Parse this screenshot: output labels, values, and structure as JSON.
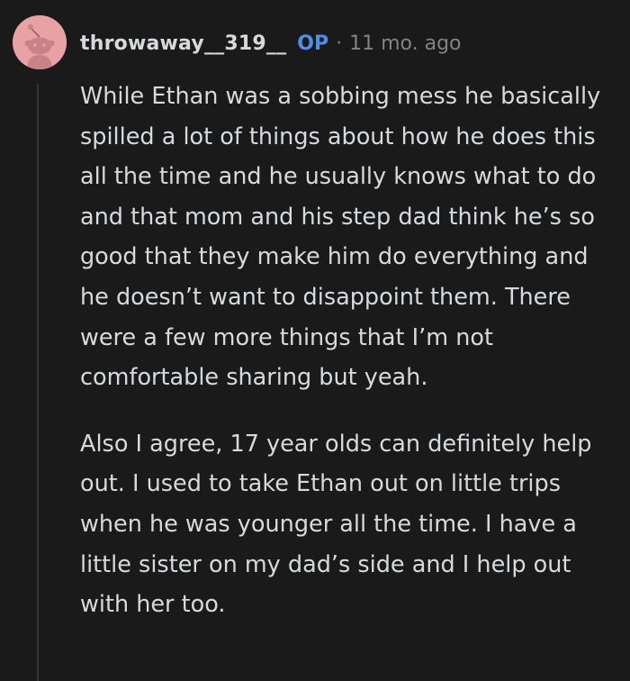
{
  "comment": {
    "author": "throwaway__319__",
    "op_badge": "OP",
    "separator": "·",
    "timestamp": "11 mo. ago",
    "avatar_icon": "snoo-avatar-icon",
    "colors": {
      "background": "#1a1a1b",
      "avatar_bg": "#e8a2a6",
      "op_badge": "#4f8fe6",
      "meta_text": "#818384",
      "body_text": "#d7dadc"
    },
    "paragraphs": [
      "While Ethan was a sobbing mess he basically spilled a lot of things about how he does this all the time and he usually knows what to do and that mom and his step dad think he’s so good that they make him do everything and he doesn’t want to disappoint them. There were a few more things that I’m not comfortable sharing but yeah.",
      "Also I agree, 17 year olds can definitely help out. I used to take Ethan out on little trips when he was younger all the time. I have a little sister on my dad’s side and I help out with her too."
    ]
  }
}
